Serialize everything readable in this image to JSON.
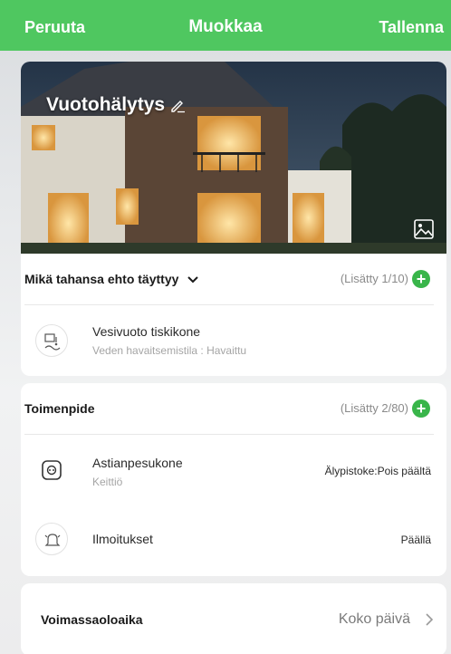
{
  "topbar": {
    "cancel_label": "Peruuta",
    "title": "Muokkaa",
    "save_label": "Tallenna",
    "color": "#4fc760"
  },
  "scene": {
    "name": "Vuotohälytys",
    "edit_icon": "pencil-icon",
    "change_image_icon": "image-icon"
  },
  "condition": {
    "label": "Mikä tahansa ehto täyttyy",
    "dropdown_icon": "chevron-down-icon",
    "count": "(Lisätty 1/10)",
    "add_icon": "plus-icon",
    "items": [
      {
        "title": "Vesivuoto tiskikone",
        "subtitle": "Veden havaitsemistila : Havaittu",
        "icon": "water-leak-icon"
      }
    ]
  },
  "actions": {
    "label": "Toimenpide",
    "count": "(Lisätty 2/80)",
    "add_icon": "plus-icon",
    "items": [
      {
        "title": "Astianpesukone",
        "subtitle": "Keittiö",
        "value": "Älypistoke:Pois päältä",
        "icon": "smart-plug-icon"
      },
      {
        "title": "Ilmoitukset",
        "value": "Päällä",
        "icon": "bell-icon"
      }
    ]
  },
  "validity": {
    "label": "Voimassaoloaika",
    "value": "Koko päivä",
    "icon": "chevron-right-icon"
  },
  "colors": {
    "accent": "#4fc760",
    "add_button": "#39b54a"
  }
}
